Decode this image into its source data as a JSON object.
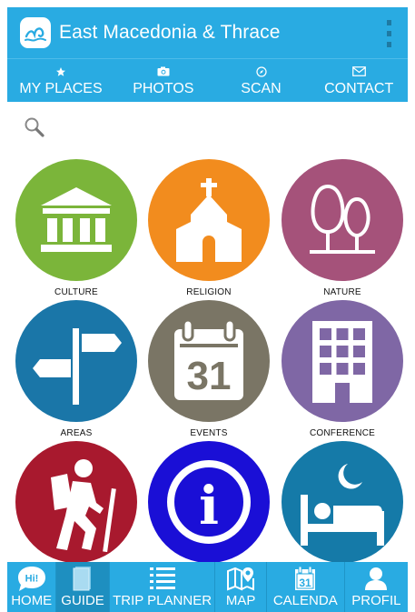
{
  "app": {
    "title": "East Macedonia & Thrace"
  },
  "top_tabs": [
    {
      "label": "MY PLACES",
      "icon": "star-icon"
    },
    {
      "label": "PHOTOS",
      "icon": "camera-icon"
    },
    {
      "label": "SCAN",
      "icon": "compass-icon"
    },
    {
      "label": "CONTACT",
      "icon": "envelope-icon"
    }
  ],
  "categories": [
    {
      "label": "CULTURE",
      "color": "#7bb53a",
      "icon": "temple-icon"
    },
    {
      "label": "RELIGION",
      "color": "#f28c1e",
      "icon": "church-icon"
    },
    {
      "label": "NATURE",
      "color": "#a5527a",
      "icon": "trees-icon"
    },
    {
      "label": "AREAS",
      "color": "#1a76a8",
      "icon": "signpost-icon"
    },
    {
      "label": "EVENTS",
      "color": "#7a7565",
      "icon": "calendar-icon",
      "day": "31"
    },
    {
      "label": "CONFERENCE",
      "color": "#7f67a5",
      "icon": "building-icon"
    },
    {
      "label": "",
      "color": "#a8192e",
      "icon": "hiker-icon"
    },
    {
      "label": "",
      "color": "#1a0fd6",
      "icon": "info-icon",
      "glyph": "i"
    },
    {
      "label": "",
      "color": "#157aa8",
      "icon": "bed-icon"
    }
  ],
  "bottom_nav": [
    {
      "label": "HOME",
      "icon": "chat-bubble-icon",
      "badge": "Hi!"
    },
    {
      "label": "GUIDE",
      "icon": "book-icon",
      "active": true
    },
    {
      "label": "TRIP PLANNER",
      "icon": "list-icon"
    },
    {
      "label": "MAP",
      "icon": "map-icon"
    },
    {
      "label": "CALENDA",
      "icon": "calendar-icon",
      "day": "31"
    },
    {
      "label": "PROFIL",
      "icon": "person-icon"
    }
  ],
  "colors": {
    "primary": "#29abe2",
    "active_tab": "#1e8fc0"
  }
}
